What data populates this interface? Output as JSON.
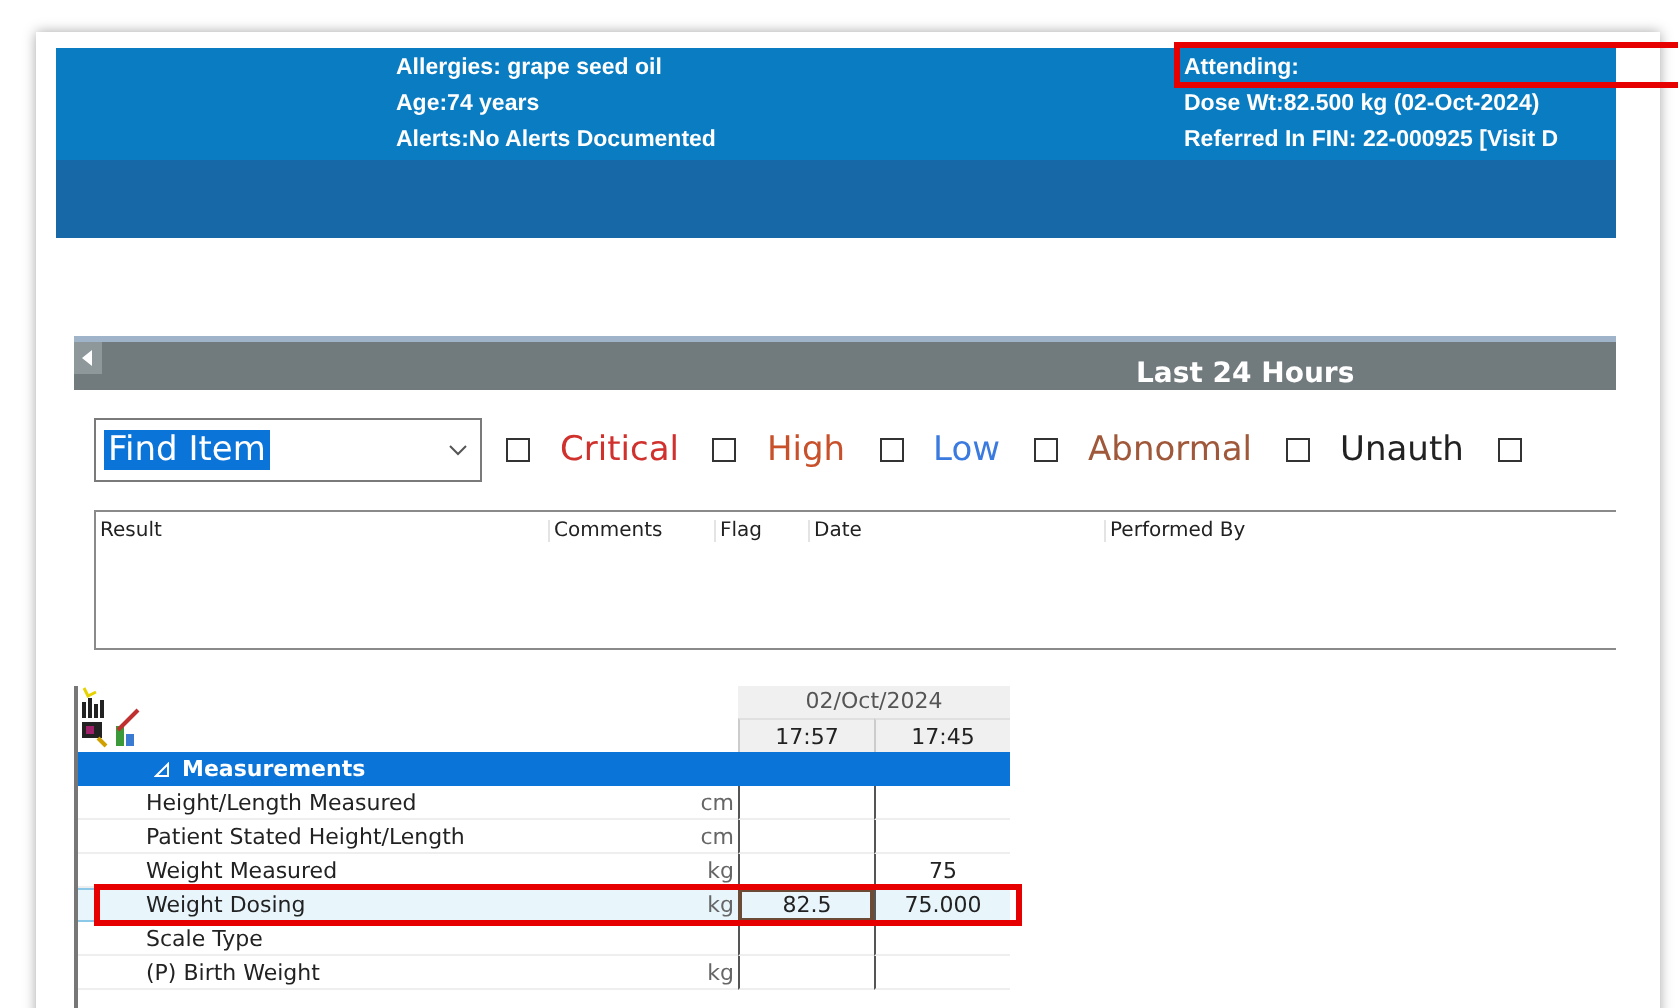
{
  "header": {
    "left_lines": [
      "Allergies: grape seed oil",
      "Age:74 years",
      "Alerts:No Alerts Documented"
    ],
    "right_lines": [
      "Attending:",
      "Dose Wt:82.500 kg (02-Oct-2024)",
      "Referred In FIN: 22-000925 [Visit D"
    ]
  },
  "banner": {
    "title": "Last 24 Hours"
  },
  "find_item": {
    "value": "Find Item"
  },
  "filters": [
    {
      "label": "Critical",
      "checked": false,
      "color": "#d0312d"
    },
    {
      "label": "High",
      "checked": false,
      "color": "#c8502a"
    },
    {
      "label": "Low",
      "checked": false,
      "color": "#3b7be0"
    },
    {
      "label": "Abnormal",
      "checked": false,
      "color": "#a0583a"
    },
    {
      "label": "Unauth",
      "checked": false,
      "color": "#222222"
    },
    {
      "checked": false
    }
  ],
  "results_table": {
    "columns": [
      "Result",
      "Comments",
      "Flag",
      "Date",
      "Performed By"
    ]
  },
  "flowsheet": {
    "date": "02/Oct/2024",
    "times": [
      "17:57",
      "17:45"
    ],
    "section": {
      "label": "Measurements",
      "expanded": true
    },
    "rows": [
      {
        "label": "Height/Length Measured",
        "unit": "cm",
        "selected": false
      },
      {
        "label": "Patient Stated Height/Length",
        "unit": "cm",
        "selected": false
      },
      {
        "label": "Weight Measured",
        "unit": "kg",
        "value_2": "75",
        "selected": false
      },
      {
        "label": "Weight Dosing",
        "unit": "kg",
        "value_1": "82.5",
        "value_2": "75.000",
        "selected": true
      },
      {
        "label": "Scale Type",
        "selected": false
      },
      {
        "label": "(P) Birth Weight",
        "unit": "kg",
        "selected": false
      }
    ]
  }
}
